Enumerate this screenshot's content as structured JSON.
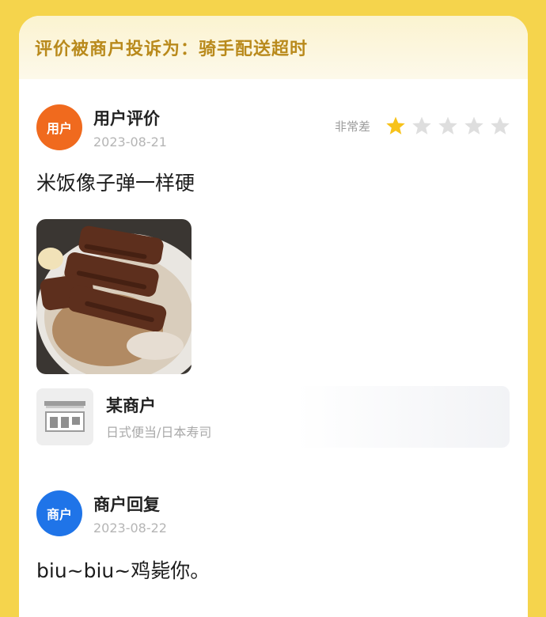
{
  "banner": {
    "text": "评价被商户投诉为：骑手配送超时"
  },
  "review": {
    "avatar_text": "用户",
    "avatar_color": "#f06a1e",
    "title": "用户评价",
    "date": "2023-08-21",
    "rating_label": "非常差",
    "rating": 1,
    "rating_max": 5,
    "text": "米饭像子弹一样硬",
    "photo_icon": "food-photo-icon"
  },
  "shop": {
    "icon": "store-icon",
    "name": "某商户",
    "category": "日式便当/日本寿司"
  },
  "reply": {
    "avatar_text": "商户",
    "avatar_color": "#1f74e8",
    "title": "商户回复",
    "date": "2023-08-22",
    "text": "biu~biu~鸡毙你。"
  }
}
